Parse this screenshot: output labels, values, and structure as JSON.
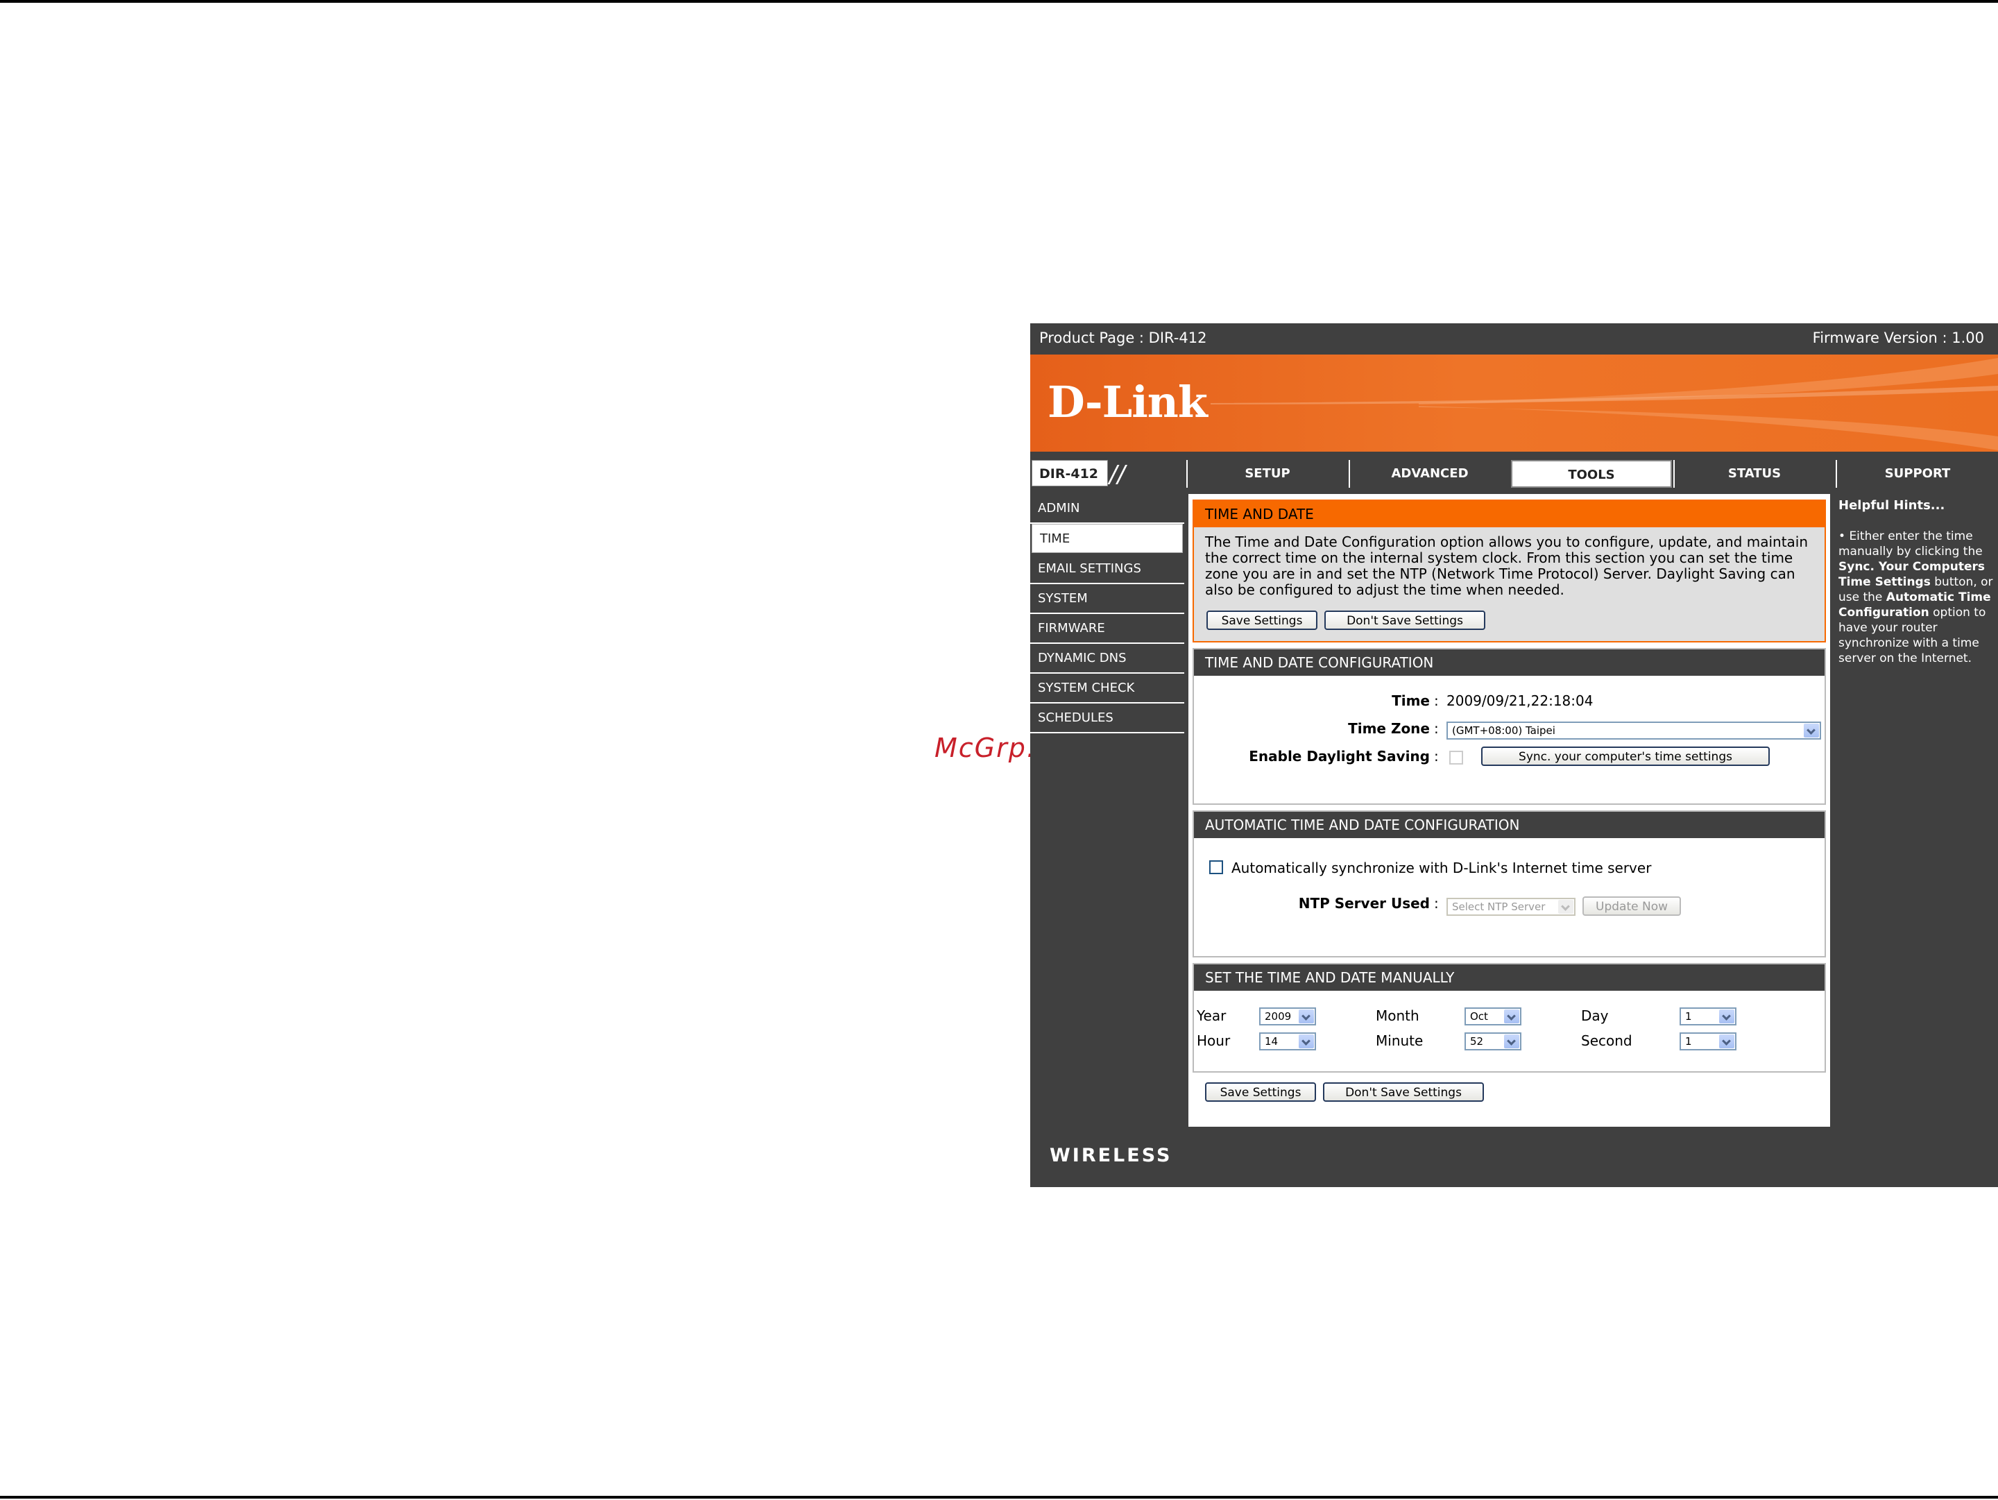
{
  "watermark": "McGrp.Ru",
  "topbar": {
    "product": "Product Page : DIR-412",
    "firmware": "Firmware Version : 1.00"
  },
  "brand": {
    "logo": "D-Link",
    "footer": "WIRELESS"
  },
  "model": "DIR-412",
  "tabs": [
    {
      "label": "SETUP"
    },
    {
      "label": "ADVANCED"
    },
    {
      "label": "TOOLS"
    },
    {
      "label": "STATUS"
    },
    {
      "label": "SUPPORT"
    }
  ],
  "active_tab": "TOOLS",
  "sidebar": {
    "items": [
      {
        "label": "ADMIN"
      },
      {
        "label": "TIME"
      },
      {
        "label": "EMAIL SETTINGS"
      },
      {
        "label": "SYSTEM"
      },
      {
        "label": "FIRMWARE"
      },
      {
        "label": "DYNAMIC DNS"
      },
      {
        "label": "SYSTEM CHECK"
      },
      {
        "label": "SCHEDULES"
      }
    ],
    "active": "TIME"
  },
  "intro": {
    "title": "TIME AND DATE",
    "text": "The Time and Date Configuration option allows you to configure, update, and maintain the correct time on the internal system clock. From this section you can set the time zone you are in and set the NTP (Network Time Protocol) Server. Daylight Saving can also be configured to adjust the time when needed.",
    "save": "Save Settings",
    "dont_save": "Don't Save Settings"
  },
  "config": {
    "title": "TIME AND DATE CONFIGURATION",
    "time_label": "Time",
    "time_value": "2009/09/21,22:18:04",
    "zone_label": "Time Zone",
    "zone_value": "(GMT+08:00) Taipei",
    "dst_label": "Enable Daylight Saving",
    "sync_button": "Sync. your computer's time settings",
    "colon": ":"
  },
  "auto": {
    "title": "AUTOMATIC TIME AND DATE CONFIGURATION",
    "checkbox_label": "Automatically synchronize with D-Link's Internet time server",
    "ntp_label": "NTP Server Used",
    "ntp_placeholder": "Select NTP Server",
    "update_button": "Update Now"
  },
  "manual": {
    "title": "SET THE TIME AND DATE MANUALLY",
    "year_label": "Year",
    "year": "2009",
    "month_label": "Month",
    "month": "Oct",
    "day_label": "Day",
    "day": "1",
    "hour_label": "Hour",
    "hour": "14",
    "minute_label": "Minute",
    "minute": "52",
    "second_label": "Second",
    "second": "1"
  },
  "bottom": {
    "save": "Save Settings",
    "dont_save": "Don't Save Settings"
  },
  "hints": {
    "title": "Helpful Hints...",
    "b1": "Either enter the time manually by clicking the ",
    "b2": "Sync. Your Computers Time Settings",
    "b3": " button, or use the ",
    "b4": "Automatic Time Configuration",
    "b5": " option to have your router synchronize with a time server on the Internet."
  },
  "colors": {
    "accent": "#f76900",
    "frame": "#404040"
  }
}
